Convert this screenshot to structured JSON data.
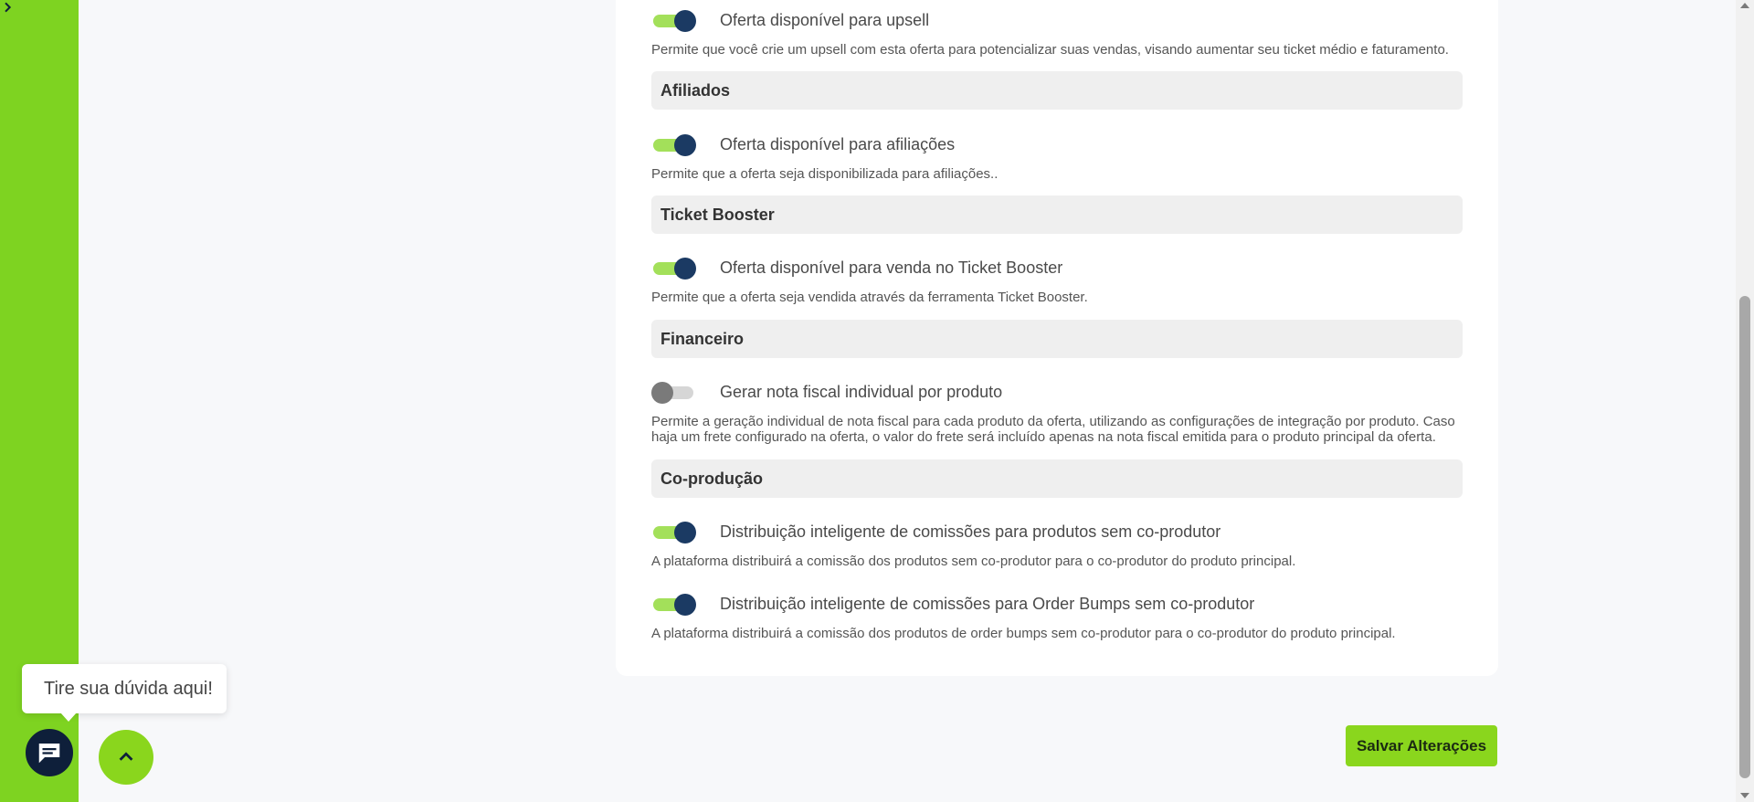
{
  "sidebar": {
    "expand_icon": "chevron-right-icon",
    "logo": "s-brand-logo",
    "items": [
      {
        "icon": "home-icon"
      },
      {
        "icon": "shopping-bag-icon"
      },
      {
        "icon": "presentation-chart-icon"
      },
      {
        "icon": "network-icon"
      },
      {
        "icon": "users-icon"
      },
      {
        "icon": "diamond-icon"
      },
      {
        "icon": "money-icon"
      },
      {
        "icon": "apps-icon"
      },
      {
        "icon": "user-circle-icon"
      }
    ]
  },
  "options": {
    "upsell": {
      "label": "Oferta disponível para upsell",
      "enabled": true,
      "description": "Permite que você crie um upsell com esta oferta para potencializar suas vendas, visando aumentar seu ticket médio e faturamento."
    },
    "affiliates_section": "Afiliados",
    "affiliates": {
      "label": "Oferta disponível para afiliações",
      "enabled": true,
      "description": "Permite que a oferta seja disponibilizada para afiliações.."
    },
    "ticket_section": "Ticket Booster",
    "ticket": {
      "label": "Oferta disponível para venda no Ticket Booster",
      "enabled": true,
      "description": "Permite que a oferta seja vendida através da ferramenta Ticket Booster."
    },
    "finance_section": "Financeiro",
    "invoice": {
      "label": "Gerar nota fiscal individual por produto",
      "enabled": false,
      "description": "Permite a geração individual de nota fiscal para cada produto da oferta, utilizando as configurações de integração por produto. Caso haja um frete configurado na oferta, o valor do frete será incluído apenas na nota fiscal emitida para o produto principal da oferta."
    },
    "coproduction_section": "Co-produção",
    "smart_products": {
      "label": "Distribuição inteligente de comissões para produtos sem co-produtor",
      "enabled": true,
      "description": "A plataforma distribuirá a comissão dos produtos sem co-produtor para o co-produtor do produto principal."
    },
    "smart_bumps": {
      "label": "Distribuição inteligente de comissões para Order Bumps sem co-produtor",
      "enabled": true,
      "description": "A plataforma distribuirá a comissão dos produtos de order bumps sem co-produtor para o co-produtor do produto principal."
    }
  },
  "actions": {
    "save_label": "Salvar Alterações"
  },
  "chat": {
    "tooltip": "Tire sua dúvida aqui!",
    "chat_icon": "chat-icon",
    "up_icon": "chevron-up-icon"
  },
  "colors": {
    "sidebar_bg": "#0e1f3a",
    "accent_green": "#8ad61d",
    "toggle_on_knob": "#1b3a63"
  }
}
